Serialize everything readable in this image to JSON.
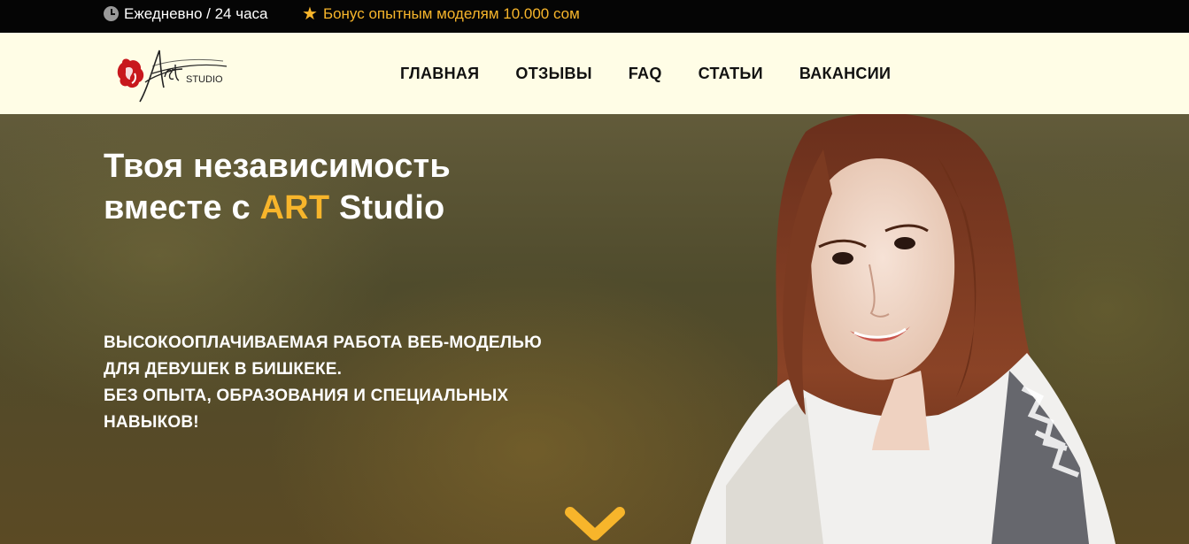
{
  "topbar": {
    "hours": "Ежедневно / 24 часа",
    "bonus": "Бонус опытным моделям 10.000 сом",
    "clock_icon": "clock-icon",
    "star_icon": "star-icon"
  },
  "header": {
    "logo_text": "Art",
    "logo_sub": "STUDIO",
    "nav": [
      "Главная",
      "Отзывы",
      "FAQ",
      "Статьи",
      "Вакансии"
    ]
  },
  "hero": {
    "title_line1": "Твоя независимость",
    "title_line2_pre": "вместе с ",
    "title_line2_accent": "ART",
    "title_line2_post": " Studio",
    "subtitle_lines": [
      "ВЫСОКООПЛАЧИВАЕМАЯ РАБОТА ВЕБ-МОДЕЛЬЮ",
      "ДЛЯ ДЕВУШЕК В БИШКЕКЕ.",
      "БЕЗ ОПЫТА, ОБРАЗОВАНИЯ И СПЕЦИАЛЬНЫХ",
      "НАВЫКОВ!"
    ],
    "scroll_icon": "chevron-down-icon"
  },
  "colors": {
    "accent": "#f7b52b",
    "topbar_bg": "#050505",
    "header_bg": "#fffde6"
  }
}
